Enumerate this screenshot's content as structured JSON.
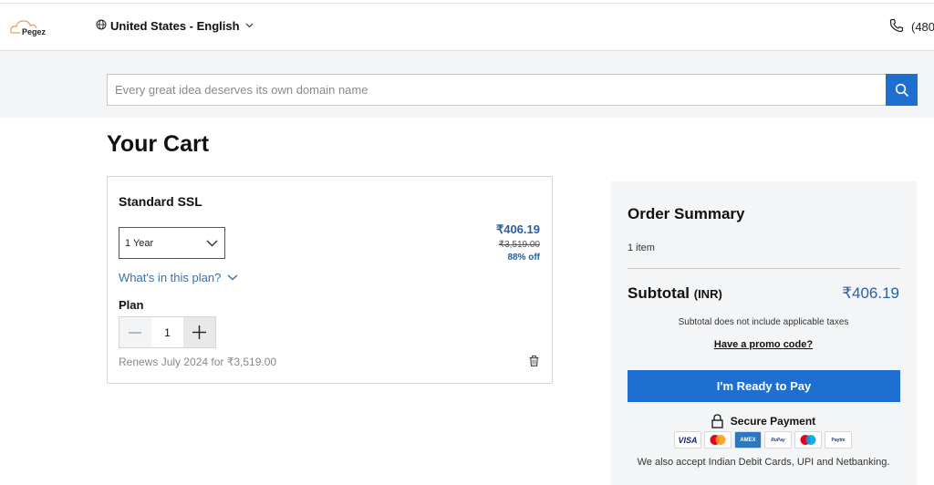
{
  "header": {
    "logo_text": "Pegez",
    "locale": "United States - English",
    "phone": "(480"
  },
  "search": {
    "placeholder": "Every great idea deserves its own domain name"
  },
  "page": {
    "title": "Your Cart"
  },
  "cart": {
    "items": [
      {
        "name": "Standard SSL",
        "term": "1 Year",
        "plan_link": "What's in this plan?",
        "plan_label": "Plan",
        "quantity": "1",
        "price": "₹406.19",
        "original_price": "₹3,519.00",
        "discount": "88% off",
        "renewal": "Renews July 2024 for ₹3,519.00"
      }
    ]
  },
  "summary": {
    "title": "Order Summary",
    "item_count": "1 item",
    "subtotal_label": "Subtotal",
    "currency": "(INR)",
    "subtotal_value": "₹406.19",
    "tax_note": "Subtotal does not include applicable taxes",
    "promo_link": "Have a promo code?",
    "pay_button": "I'm Ready to Pay",
    "secure_label": "Secure Payment",
    "payment_methods": [
      "VISA",
      "Mastercard",
      "AMEX",
      "RuPay",
      "Maestro",
      "Paytm"
    ],
    "accept_note": "We also accept Indian Debit Cards, UPI and Netbanking."
  },
  "colors": {
    "accent": "#1f6fd0",
    "link": "#3b6ea8",
    "price": "#2b5f9e",
    "band_bg": "#f3f5f7"
  }
}
